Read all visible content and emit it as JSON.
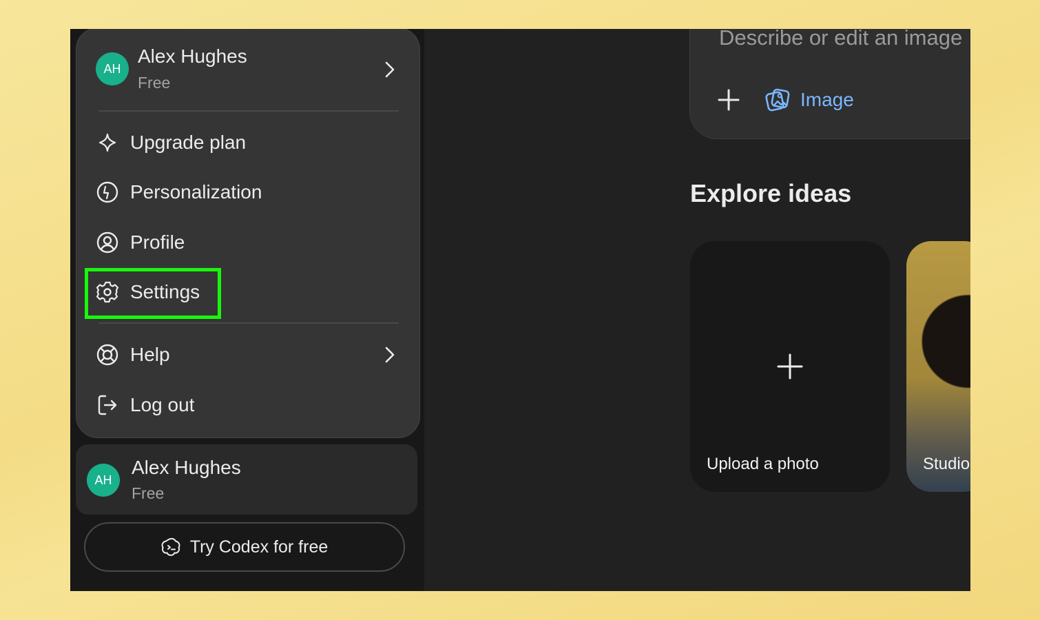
{
  "account": {
    "initials": "AH",
    "name": "Alex Hughes",
    "plan": "Free"
  },
  "menu": {
    "items": [
      {
        "label": "Upgrade plan",
        "icon": "sparkle-icon"
      },
      {
        "label": "Personalization",
        "icon": "personalization-icon"
      },
      {
        "label": "Profile",
        "icon": "profile-icon"
      },
      {
        "label": "Settings",
        "icon": "gear-icon",
        "highlighted": true
      },
      {
        "label": "Help",
        "icon": "lifebuoy-icon",
        "has_submenu": true
      },
      {
        "label": "Log out",
        "icon": "logout-icon"
      }
    ]
  },
  "codex_button": {
    "label": "Try Codex for free"
  },
  "prompt": {
    "placeholder": "Describe or edit an image",
    "image_label": "Image"
  },
  "explore": {
    "title": "Explore ideas",
    "cards": [
      {
        "label": "Upload a photo"
      },
      {
        "label": "Studio"
      }
    ]
  },
  "colors": {
    "highlight": "#19f50c",
    "avatar": "#19b08c",
    "accent_link": "#7ab7ff"
  }
}
